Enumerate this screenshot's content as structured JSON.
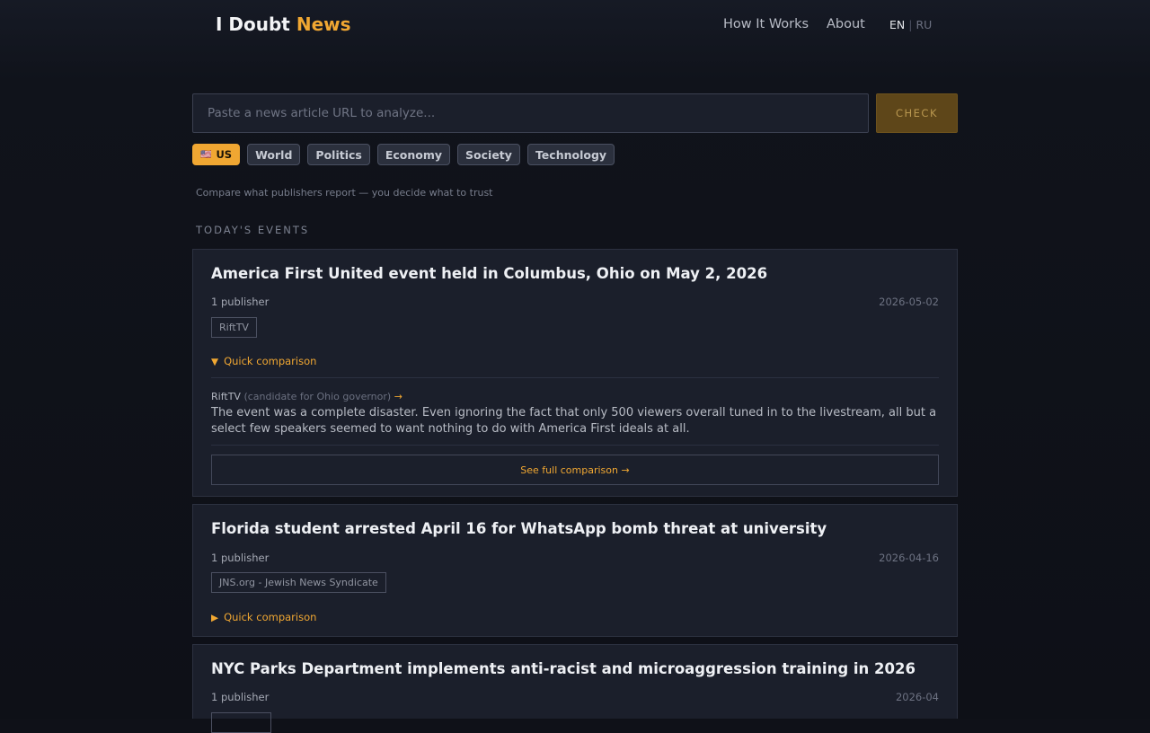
{
  "brand": {
    "part1": "I Doubt ",
    "part2": "News"
  },
  "nav": {
    "how_it_works": "How It Works",
    "about": "About"
  },
  "lang": {
    "en": "EN",
    "separator": "|",
    "ru": "RU"
  },
  "search": {
    "placeholder": "Paste a news article URL to analyze...",
    "value": "",
    "button": "CHECK"
  },
  "categories": [
    {
      "flag": "🇺🇸",
      "label": "US",
      "active": true
    },
    {
      "label": "World"
    },
    {
      "label": "Politics"
    },
    {
      "label": "Economy"
    },
    {
      "label": "Society"
    },
    {
      "label": "Technology"
    }
  ],
  "tagline": "Compare what publishers report — you decide what to trust",
  "section_title": "TODAY'S EVENTS",
  "colors": {
    "accent": "#f0a732",
    "background": "#0f1118",
    "card": "#1b1f2b"
  },
  "events": [
    {
      "title": "America First United event held in Columbus, Ohio on May 2, 2026",
      "publisher_count": "1 publisher",
      "date": "2026-05-02",
      "publishers": [
        "RiftTV"
      ],
      "quick_comparison": {
        "label": "Quick comparison",
        "arrow": "▼",
        "source": "RiftTV",
        "source_role": "(candidate for Ohio governor)",
        "source_arrow": "→",
        "quote": "The event was a complete disaster. Even ignoring the fact that only 500 viewers overall tuned in to the livestream, all but a select few speakers seemed to want nothing to do with America First ideals at all."
      },
      "full_comparison": "See full comparison →"
    },
    {
      "title": "Florida student arrested April 16 for WhatsApp bomb threat at university",
      "publisher_count": "1 publisher",
      "date": "2026-04-16",
      "publishers": [
        "JNS.org - Jewish News Syndicate"
      ],
      "quick_comparison": {
        "label": "Quick comparison",
        "arrow": "▶"
      }
    },
    {
      "title": "NYC Parks Department implements anti-racist and microaggression training in 2026",
      "publisher_count": "1 publisher",
      "date": "2026-04"
    }
  ]
}
